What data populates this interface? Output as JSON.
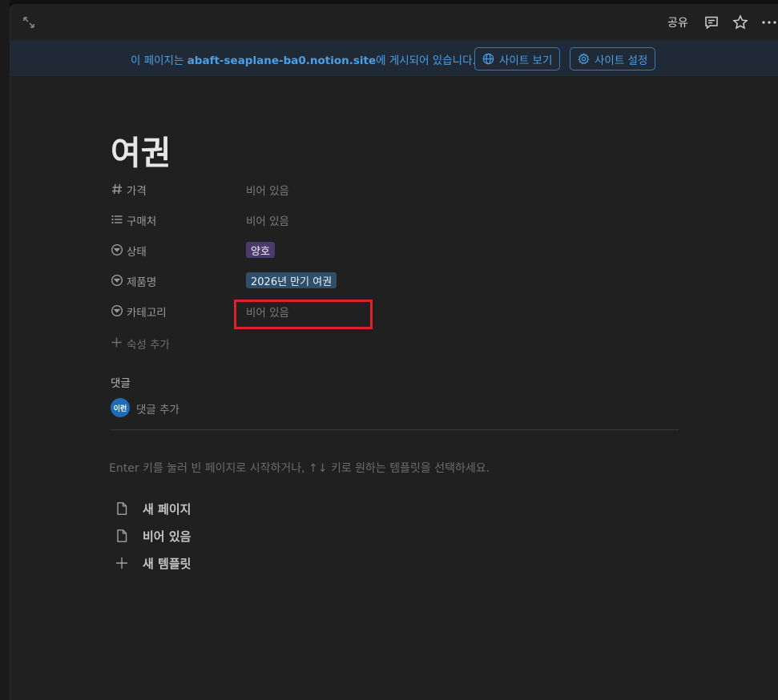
{
  "topbar": {
    "share_label": "공유",
    "icons": [
      "expand-icon",
      "comment-icon",
      "star-icon",
      "more-icon"
    ]
  },
  "banner": {
    "text_before": "이 페이지는 ",
    "site": "abaft-seaplane-ba0.notion.site",
    "text_after": "에 게시되어 있습니다.",
    "view_site_label": "사이트 보기",
    "site_settings_label": "사이트 설정",
    "color": "#4a9fe6"
  },
  "page": {
    "title": "여권"
  },
  "properties": [
    {
      "icon": "hash-icon",
      "label": "가격",
      "value": "비어 있음",
      "type": "empty"
    },
    {
      "icon": "list-icon",
      "label": "구매처",
      "value": "비어 있음",
      "type": "empty"
    },
    {
      "icon": "select-icon",
      "label": "상태",
      "value": "양호",
      "type": "tag",
      "color": "#4b3a6e"
    },
    {
      "icon": "select-icon",
      "label": "제품명",
      "value": "2026년 만기 여권",
      "type": "tag",
      "color": "#2d4f6a"
    },
    {
      "icon": "select-icon",
      "label": "카테고리",
      "value": "비어 있음",
      "type": "empty"
    }
  ],
  "add_property_label": "숙성 추가",
  "comments": {
    "heading": "댓글",
    "avatar_text": "이런",
    "add_label": "댓글 추가"
  },
  "template_hint": "Enter 키를 눌러 빈 페이지로 시작하거나, ↑↓ 키로 원하는 템플릿을 선택하세요.",
  "templates": [
    {
      "icon": "page-icon",
      "label": "새 페이지"
    },
    {
      "icon": "page-icon",
      "label": "비어 있음"
    },
    {
      "icon": "plus-icon",
      "label": "새 템플릿"
    }
  ],
  "highlight_color": "#e0202a"
}
